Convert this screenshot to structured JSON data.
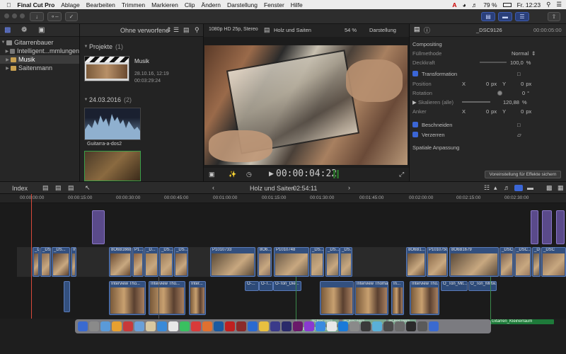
{
  "menubar": {
    "app": "Final Cut Pro",
    "items": [
      "Ablage",
      "Bearbeiten",
      "Trimmen",
      "Markieren",
      "Clip",
      "Ändern",
      "Darstellung",
      "Fenster",
      "Hilfe"
    ],
    "battery": "79 %",
    "clock": "Fr. 12:23"
  },
  "libraries": {
    "root": "Gitarrenbauer",
    "items": [
      "Intelligent...mmlungen",
      "Musik",
      "Saitenmann"
    ]
  },
  "browser": {
    "filter": "Ohne verworfene",
    "section_projects": "Projekte",
    "projects_count": "(1)",
    "project_name": "Musik",
    "project_date": "28.10.16, 12:19",
    "project_duration": "00:03:29:24",
    "section_date": "24.03.2016",
    "date_count": "(2)",
    "clip_name": "Guitarra-a-dos2"
  },
  "viewer": {
    "format": "1080p HD 25p, Stereo",
    "project": "Holz und Saiten",
    "zoom": "54 %",
    "view_menu": "Darstellung",
    "timecode": "00:00:04:22"
  },
  "inspector": {
    "clip_title": "_DSC9126",
    "clip_time": "00:00:05:00",
    "compositing": "Compositing",
    "blend_label": "Füllmethode",
    "blend_value": "Normal",
    "opacity_label": "Deckkraft",
    "opacity_value": "100,0",
    "opacity_unit": "%",
    "transform": "Transformation",
    "position_label": "Position",
    "position_x": "0",
    "position_y": "0",
    "px": "px",
    "rotation_label": "Rotation",
    "rotation_value": "0",
    "deg": "°",
    "scale_label": "Skalieren (alle)",
    "scale_value": "120,88",
    "anchor_label": "Anker",
    "anchor_x": "0",
    "anchor_y": "0",
    "crop": "Beschneiden",
    "distort": "Verzerren",
    "spatial": "Spatiale Anpassung",
    "save_preset": "Voreinstellung für Effekte sichern"
  },
  "timeline": {
    "index": "Index",
    "title": "Holz und Saiten",
    "duration": "02:54:11",
    "ruler": [
      "00:00:00:00",
      "00:00:15:00",
      "00:00:30:00",
      "00:00:45:00",
      "00:01:00:00",
      "00:01:15:00",
      "00:01:30:00",
      "00:01:45:00",
      "00:02:00:00",
      "00:02:15:00",
      "00:02:30:00"
    ],
    "main_clips": [
      "_D...",
      "_DSCS...",
      "_DS...",
      "In...",
      "8O6B1668",
      "P1...",
      "_D...",
      "_DS...",
      "_DS...",
      "P1010733",
      "8O6...",
      "P1010748",
      "_DS...",
      "_DS...",
      "_DS...",
      "8O6B1...",
      "P1010750",
      "8O6B1679",
      "_DSC...",
      "_DSC...",
      "_DSC...",
      "_DSC"
    ],
    "connected": [
      "Interview Tho...",
      "Interview Tho...",
      "Inter...",
      "O-...",
      "O-T...",
      "O-Ton_Die...",
      "Interview Thomas...",
      "In...",
      "Interview Tho...",
      "O_Ton_Mit...",
      "O_Ton_Mittw..."
    ],
    "audio": [
      "8O6B1669",
      "8O6B1669",
      "8O6B1669",
      "Gitarren_Kleinerraum",
      "Gitarren_Kleinerraum"
    ]
  },
  "colors": {
    "accent": "#3b66d6",
    "clip_blue": "#33507f",
    "audio_green": "#1e7a3a",
    "playhead": "#d94a3a"
  }
}
